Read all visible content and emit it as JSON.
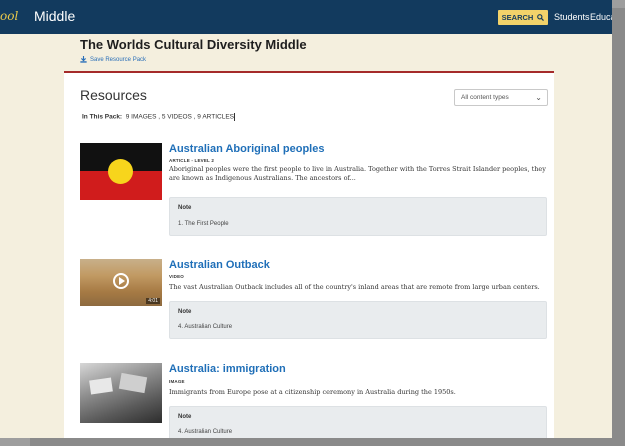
{
  "header": {
    "logo_fragment": "ool",
    "brand": "Middle",
    "search_label": "SEARCH",
    "nav": [
      "Students",
      "Educa"
    ]
  },
  "page": {
    "title": "The Worlds Cultural Diversity Middle",
    "save_label": "Save Resource Pack"
  },
  "resources": {
    "heading": "Resources",
    "filter_selected": "All content types",
    "in_pack_label": "In This Pack:",
    "in_pack_counts": "9 IMAGES ,  5 VIDEOS ,  9 ARTICLES",
    "items": [
      {
        "title": "Australian Aboriginal peoples",
        "type": "ARTICLE - LEVEL 2",
        "description": "Aboriginal peoples were the first people to live in Australia. Together with the Torres Strait Islander peoples, they are known as Indigenous Australians. The ancestors of...",
        "note_label": "Note",
        "note_text": "1. The First People"
      },
      {
        "title": "Australian Outback",
        "type": "VIDEO",
        "duration": "4:01",
        "description": "The vast Australian Outback includes all of the country's inland areas that are remote from large urban centers.",
        "note_label": "Note",
        "note_text": "4. Australian Culture"
      },
      {
        "title": "Australia: immigration",
        "type": "IMAGE",
        "description": "Immigrants from Europe pose at a citizenship ceremony in Australia during the 1950s.",
        "note_label": "Note",
        "note_text": "4. Australian Culture"
      }
    ]
  },
  "colors": {
    "header_bg": "#123a5e",
    "accent_yellow": "#f2d26a",
    "link_blue": "#1f6fb8",
    "rule_red": "#a52a2a"
  }
}
